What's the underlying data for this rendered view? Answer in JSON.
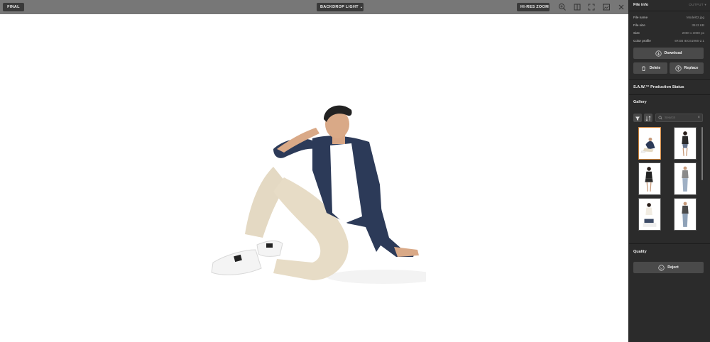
{
  "toolbar": {
    "final_label": "FINAL",
    "backdrop_label": "BACKDROP LIGHT",
    "backdrop_chevron": "⌄",
    "zoom_label": "HI-RES ZOOM",
    "icons": [
      "zoom-icon",
      "compare-split-icon",
      "fullscreen-icon",
      "overlay-icon",
      "close-icon"
    ]
  },
  "panel": {
    "file_info": {
      "title": "File info",
      "output_label": "OUTPUT",
      "rows": [
        {
          "label": "File name",
          "value": "Model02.jpg"
        },
        {
          "label": "File size",
          "value": "3513 KB"
        },
        {
          "label": "Size",
          "value": "2000 x 3000 px"
        },
        {
          "label": "Color profile",
          "value": "sRGB IEC61966-2.1"
        }
      ],
      "download_label": "Download",
      "delete_label": "Delete",
      "replace_label": "Replace"
    },
    "production_status_title": "S.A.W.™ Production Status",
    "gallery": {
      "title": "Gallery",
      "search_placeholder": "Search",
      "clear_label": "×"
    },
    "quality": {
      "title": "Quality",
      "reject_label": "Reject"
    }
  },
  "colors": {
    "selected_thumb_border": "#d2853a",
    "panel_bg": "#2b2b2b",
    "toolbar_bg": "#777777",
    "button_bg": "#4a4a4a"
  }
}
